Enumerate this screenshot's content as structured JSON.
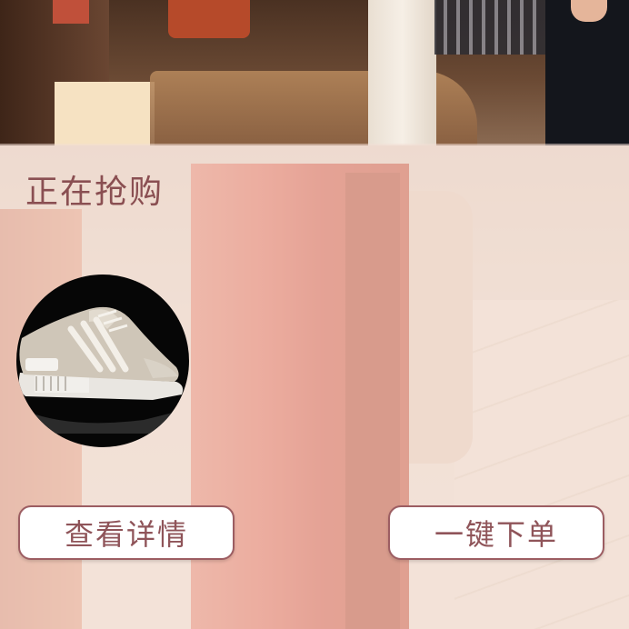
{
  "section": {
    "title": "正在抢购"
  },
  "product": {
    "image_icon": "sneaker-product-image"
  },
  "actions": {
    "details_label": "查看详情",
    "order_label": "一键下单"
  },
  "colors": {
    "title_text": "#8a4f52",
    "button_border": "#9c5d62",
    "button_text": "#8f5459",
    "button_bg": "#ffffff",
    "overlay": "rgba(242,222,214,0.55)"
  }
}
